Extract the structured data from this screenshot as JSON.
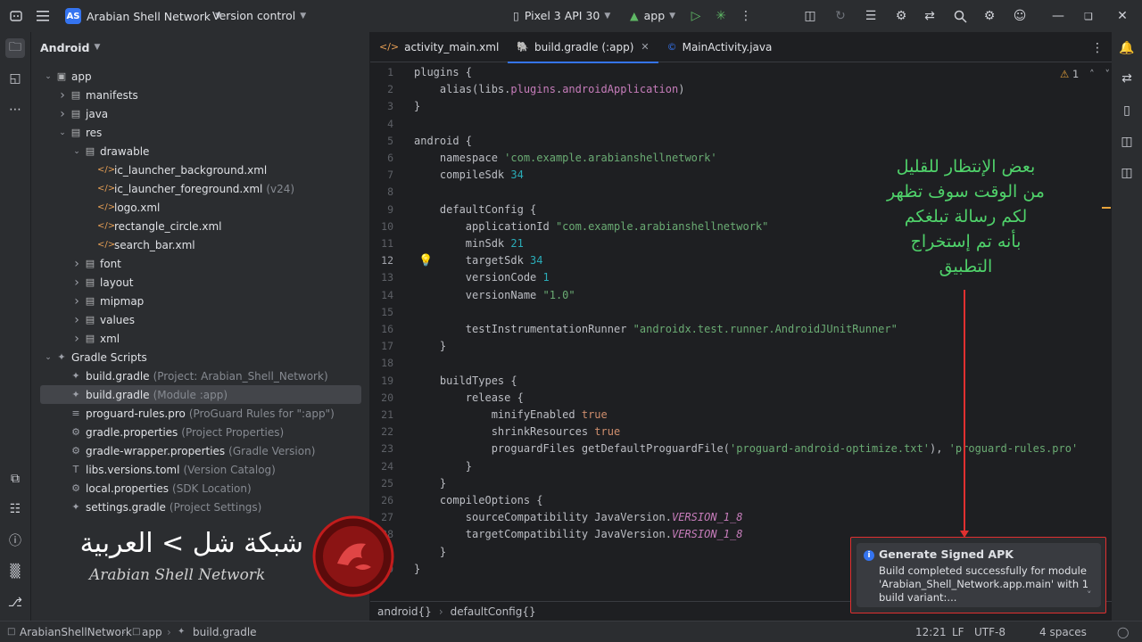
{
  "titlebar": {
    "project_badge": "AS",
    "project_name": "Arabian Shell Network",
    "vcs": "Version control",
    "device": "Pixel 3 API 30",
    "run_config": "app"
  },
  "project_panel": {
    "view": "Android",
    "tree": [
      {
        "label": "app",
        "hint": "",
        "depth": 0,
        "arrow": "open",
        "icon": "module"
      },
      {
        "label": "manifests",
        "hint": "",
        "depth": 1,
        "arrow": "closed",
        "icon": "folder"
      },
      {
        "label": "java",
        "hint": "",
        "depth": 1,
        "arrow": "closed",
        "icon": "folder"
      },
      {
        "label": "res",
        "hint": "",
        "depth": 1,
        "arrow": "open",
        "icon": "folder"
      },
      {
        "label": "drawable",
        "hint": "",
        "depth": 2,
        "arrow": "open",
        "icon": "folder"
      },
      {
        "label": "ic_launcher_background.xml",
        "hint": "",
        "depth": 3,
        "arrow": "none",
        "icon": "xml"
      },
      {
        "label": "ic_launcher_foreground.xml",
        "hint": "(v24)",
        "depth": 3,
        "arrow": "none",
        "icon": "xml"
      },
      {
        "label": "logo.xml",
        "hint": "",
        "depth": 3,
        "arrow": "none",
        "icon": "xml"
      },
      {
        "label": "rectangle_circle.xml",
        "hint": "",
        "depth": 3,
        "arrow": "none",
        "icon": "xml"
      },
      {
        "label": "search_bar.xml",
        "hint": "",
        "depth": 3,
        "arrow": "none",
        "icon": "xml"
      },
      {
        "label": "font",
        "hint": "",
        "depth": 2,
        "arrow": "closed",
        "icon": "folder"
      },
      {
        "label": "layout",
        "hint": "",
        "depth": 2,
        "arrow": "closed",
        "icon": "folder"
      },
      {
        "label": "mipmap",
        "hint": "",
        "depth": 2,
        "arrow": "closed",
        "icon": "folder"
      },
      {
        "label": "values",
        "hint": "",
        "depth": 2,
        "arrow": "closed",
        "icon": "folder"
      },
      {
        "label": "xml",
        "hint": "",
        "depth": 2,
        "arrow": "closed",
        "icon": "folder"
      },
      {
        "label": "Gradle Scripts",
        "hint": "",
        "depth": 0,
        "arrow": "open",
        "icon": "gradle"
      },
      {
        "label": "build.gradle",
        "hint": "(Project: Arabian_Shell_Network)",
        "depth": 1,
        "arrow": "none",
        "icon": "gradle"
      },
      {
        "label": "build.gradle",
        "hint": "(Module :app)",
        "depth": 1,
        "arrow": "none",
        "icon": "gradle",
        "selected": true
      },
      {
        "label": "proguard-rules.pro",
        "hint": "(ProGuard Rules for \":app\")",
        "depth": 1,
        "arrow": "none",
        "icon": "text"
      },
      {
        "label": "gradle.properties",
        "hint": "(Project Properties)",
        "depth": 1,
        "arrow": "none",
        "icon": "settings"
      },
      {
        "label": "gradle-wrapper.properties",
        "hint": "(Gradle Version)",
        "depth": 1,
        "arrow": "none",
        "icon": "settings"
      },
      {
        "label": "libs.versions.toml",
        "hint": "(Version Catalog)",
        "depth": 1,
        "arrow": "none",
        "icon": "toml"
      },
      {
        "label": "local.properties",
        "hint": "(SDK Location)",
        "depth": 1,
        "arrow": "none",
        "icon": "settings"
      },
      {
        "label": "settings.gradle",
        "hint": "(Project Settings)",
        "depth": 1,
        "arrow": "none",
        "icon": "gradle"
      }
    ]
  },
  "tabs": [
    {
      "label": "activity_main.xml",
      "icon": "</>",
      "active": false,
      "close": false
    },
    {
      "label": "build.gradle (:app)",
      "icon": "🐘",
      "active": true,
      "close": true
    },
    {
      "label": "MainActivity.java",
      "icon": "©",
      "active": false,
      "close": false
    }
  ],
  "editor": {
    "warnings": "1",
    "current_line": 12,
    "lines": [
      "plugins {",
      "    alias(libs.plugins.androidApplication)",
      "}",
      "",
      "android {",
      "    namespace 'com.example.arabianshellnetwork'",
      "    compileSdk 34",
      "",
      "    defaultConfig {",
      "        applicationId \"com.example.arabianshellnetwork\"",
      "        minSdk 21",
      "        targetSdk 34",
      "        versionCode 1",
      "        versionName \"1.0\"",
      "",
      "        testInstrumentationRunner \"androidx.test.runner.AndroidJUnitRunner\"",
      "    }",
      "",
      "    buildTypes {",
      "        release {",
      "            minifyEnabled true",
      "            shrinkResources true",
      "            proguardFiles getDefaultProguardFile('proguard-android-optimize.txt'), 'proguard-rules.pro'",
      "        }",
      "    }",
      "    compileOptions {",
      "        sourceCompatibility JavaVersion.VERSION_1_8",
      "        targetCompatibility JavaVersion.VERSION_1_8",
      "    }",
      "}"
    ],
    "breadcrumbs": [
      "android{}",
      "defaultConfig{}"
    ]
  },
  "notification": {
    "title": "Generate Signed APK",
    "body_line1": "Build completed successfully for module",
    "body_line2": "'Arabian_Shell_Network.app.main' with 1",
    "body_line3": "build variant:..."
  },
  "annotation": {
    "lines": [
      "بعض الإنتظار للقليل",
      "من الوقت سوف تظهر",
      "لكم رسالة تبلغكم",
      "بأنه تم إستخراج",
      "التطبيق"
    ],
    "color": "#4fd16a",
    "arrow_color": "#e03030"
  },
  "watermark": {
    "arabic": "شبكة شل > العربية",
    "english": "Arabian Shell Network"
  },
  "statusbar": {
    "path": [
      "ArabianShellNetwork",
      "app",
      "build.gradle"
    ],
    "position": "12:21",
    "line_sep": "LF",
    "encoding": "UTF-8",
    "indent": "4 spaces"
  }
}
